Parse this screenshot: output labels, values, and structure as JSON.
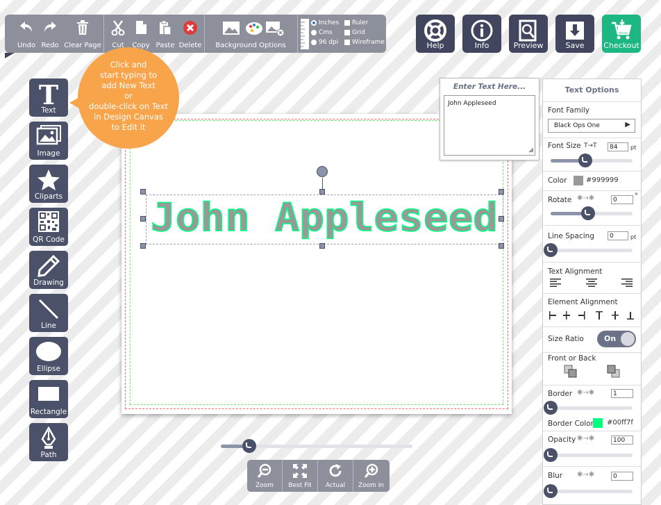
{
  "toolbar": {
    "undo": "Undo",
    "redo": "Redo",
    "clear": "Clear Page",
    "cut": "Cut",
    "copy": "Copy",
    "paste": "Paste",
    "delete": "Delete",
    "background": "Background Options",
    "units": {
      "inches": "Inches",
      "cms": "Cms",
      "dpi": "96 dpi",
      "selected": "Inches"
    },
    "checks": {
      "ruler": "Ruler",
      "grid": "Grid",
      "wireframe": "Wireframe"
    }
  },
  "top_actions": {
    "help": "Help",
    "info": "Info",
    "preview": "Preview",
    "save": "Save",
    "checkout": "Checkout"
  },
  "tools": [
    {
      "label": "Text",
      "icon": "text-icon"
    },
    {
      "label": "Image",
      "icon": "image-icon"
    },
    {
      "label": "Cliparts",
      "icon": "star-icon"
    },
    {
      "label": "QR Code",
      "icon": "qr-code-icon"
    },
    {
      "label": "Drawing",
      "icon": "pencil-icon"
    },
    {
      "label": "Line",
      "icon": "line-icon"
    },
    {
      "label": "Ellipse",
      "icon": "ellipse-icon"
    },
    {
      "label": "Rectangle",
      "icon": "rectangle-icon"
    },
    {
      "label": "Path",
      "icon": "pen-nib-icon"
    }
  ],
  "tooltip": {
    "lines": [
      "Click and",
      "start typing to",
      "add New Text",
      "or",
      "double-click on Text",
      "in Design Canvas",
      "to Edit it"
    ]
  },
  "canvas": {
    "text": "John Appleseed",
    "text_fill": "#999999",
    "text_stroke": "#00ff7f"
  },
  "text_input": {
    "header": "Enter Text Here...",
    "value": "John Appleseed"
  },
  "text_options": {
    "title": "Text Options",
    "font_family_label": "Font Family",
    "font_family_value": "Black Ops One",
    "font_size_label": "Font Size",
    "font_size_value": "84",
    "font_size_unit": "pt",
    "font_size_level": 0.42,
    "color_label": "Color",
    "color_value": "#999999",
    "rotate_label": "Rotate",
    "rotate_value": "0",
    "rotate_unit": "°",
    "rotate_level": 0.46,
    "line_spacing_label": "Line Spacing",
    "line_spacing_value": "0",
    "line_spacing_unit": "pt",
    "line_spacing_level": 0,
    "text_alignment_label": "Text Alignment",
    "element_alignment_label": "Element Alignment",
    "size_ratio_label": "Size Ratio",
    "size_ratio_value": "On",
    "front_back_label": "Front or Back",
    "border_label": "Border",
    "border_value": "1",
    "border_level": 0,
    "border_color_label": "Border Color",
    "border_color_value": "#00ff7f",
    "opacity_label": "Opacity",
    "opacity_value": "100",
    "opacity_level": 0,
    "blur_label": "Blur",
    "blur_value": "0",
    "blur_level": 0
  },
  "zoom": {
    "zoom_out": "Zoom",
    "best_fit": "Best Fit",
    "actual": "Actual",
    "zoom_in": "Zoom In",
    "level": 0.15
  }
}
